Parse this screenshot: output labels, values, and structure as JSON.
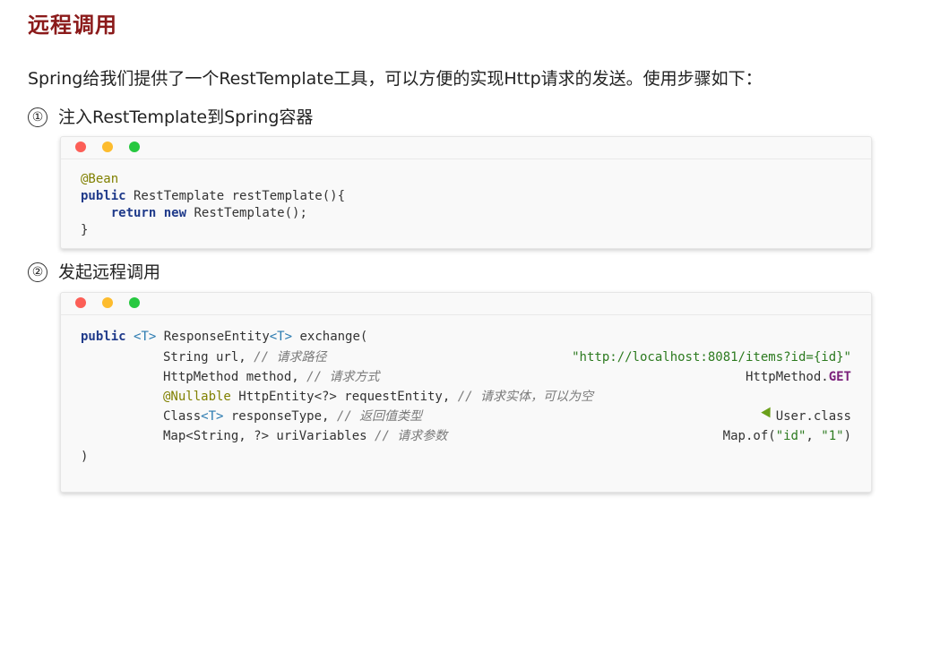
{
  "title": "远程调用",
  "intro": "Spring给我们提供了一个RestTemplate工具，可以方便的实现Http请求的发送。使用步骤如下：",
  "steps": [
    {
      "num": "①",
      "label": "注入RestTemplate到Spring容器"
    },
    {
      "num": "②",
      "label": "发起远程调用"
    }
  ],
  "code1": {
    "annotation": "@Bean",
    "kw_public": "public",
    "sig_rest": " RestTemplate restTemplate(){",
    "kw_return": "return",
    "kw_new": "new",
    "ret_rest": " RestTemplate();",
    "close": "}"
  },
  "code2": {
    "kw_public": "public",
    "generic_t": "<T>",
    "sig_a": " ResponseEntity",
    "sig_b": " exchange(",
    "params": [
      {
        "code": "String url, ",
        "comment": "// 请求路径",
        "value": "\"http://localhost:8081/items?id={id}\""
      },
      {
        "code": "HttpMethod method, ",
        "comment": "// 请求方式",
        "value_prefix": "HttpMethod.",
        "value_bold": "GET"
      },
      {
        "annotation": "@Nullable",
        "code": " HttpEntity<?> requestEntity, ",
        "comment": "// 请求实体，可以为空"
      },
      {
        "code_a": "Class",
        "code_b": " responseType, ",
        "comment": "// 返回值类型",
        "value": "User.class"
      },
      {
        "code": "Map<String, ?> uriVariables ",
        "comment": "// 请求参数",
        "value_prefix": "Map.of(",
        "str1": "\"id\"",
        "sep": ", ",
        "str2": "\"1\"",
        "value_suffix": ")"
      }
    ],
    "close": ")"
  }
}
